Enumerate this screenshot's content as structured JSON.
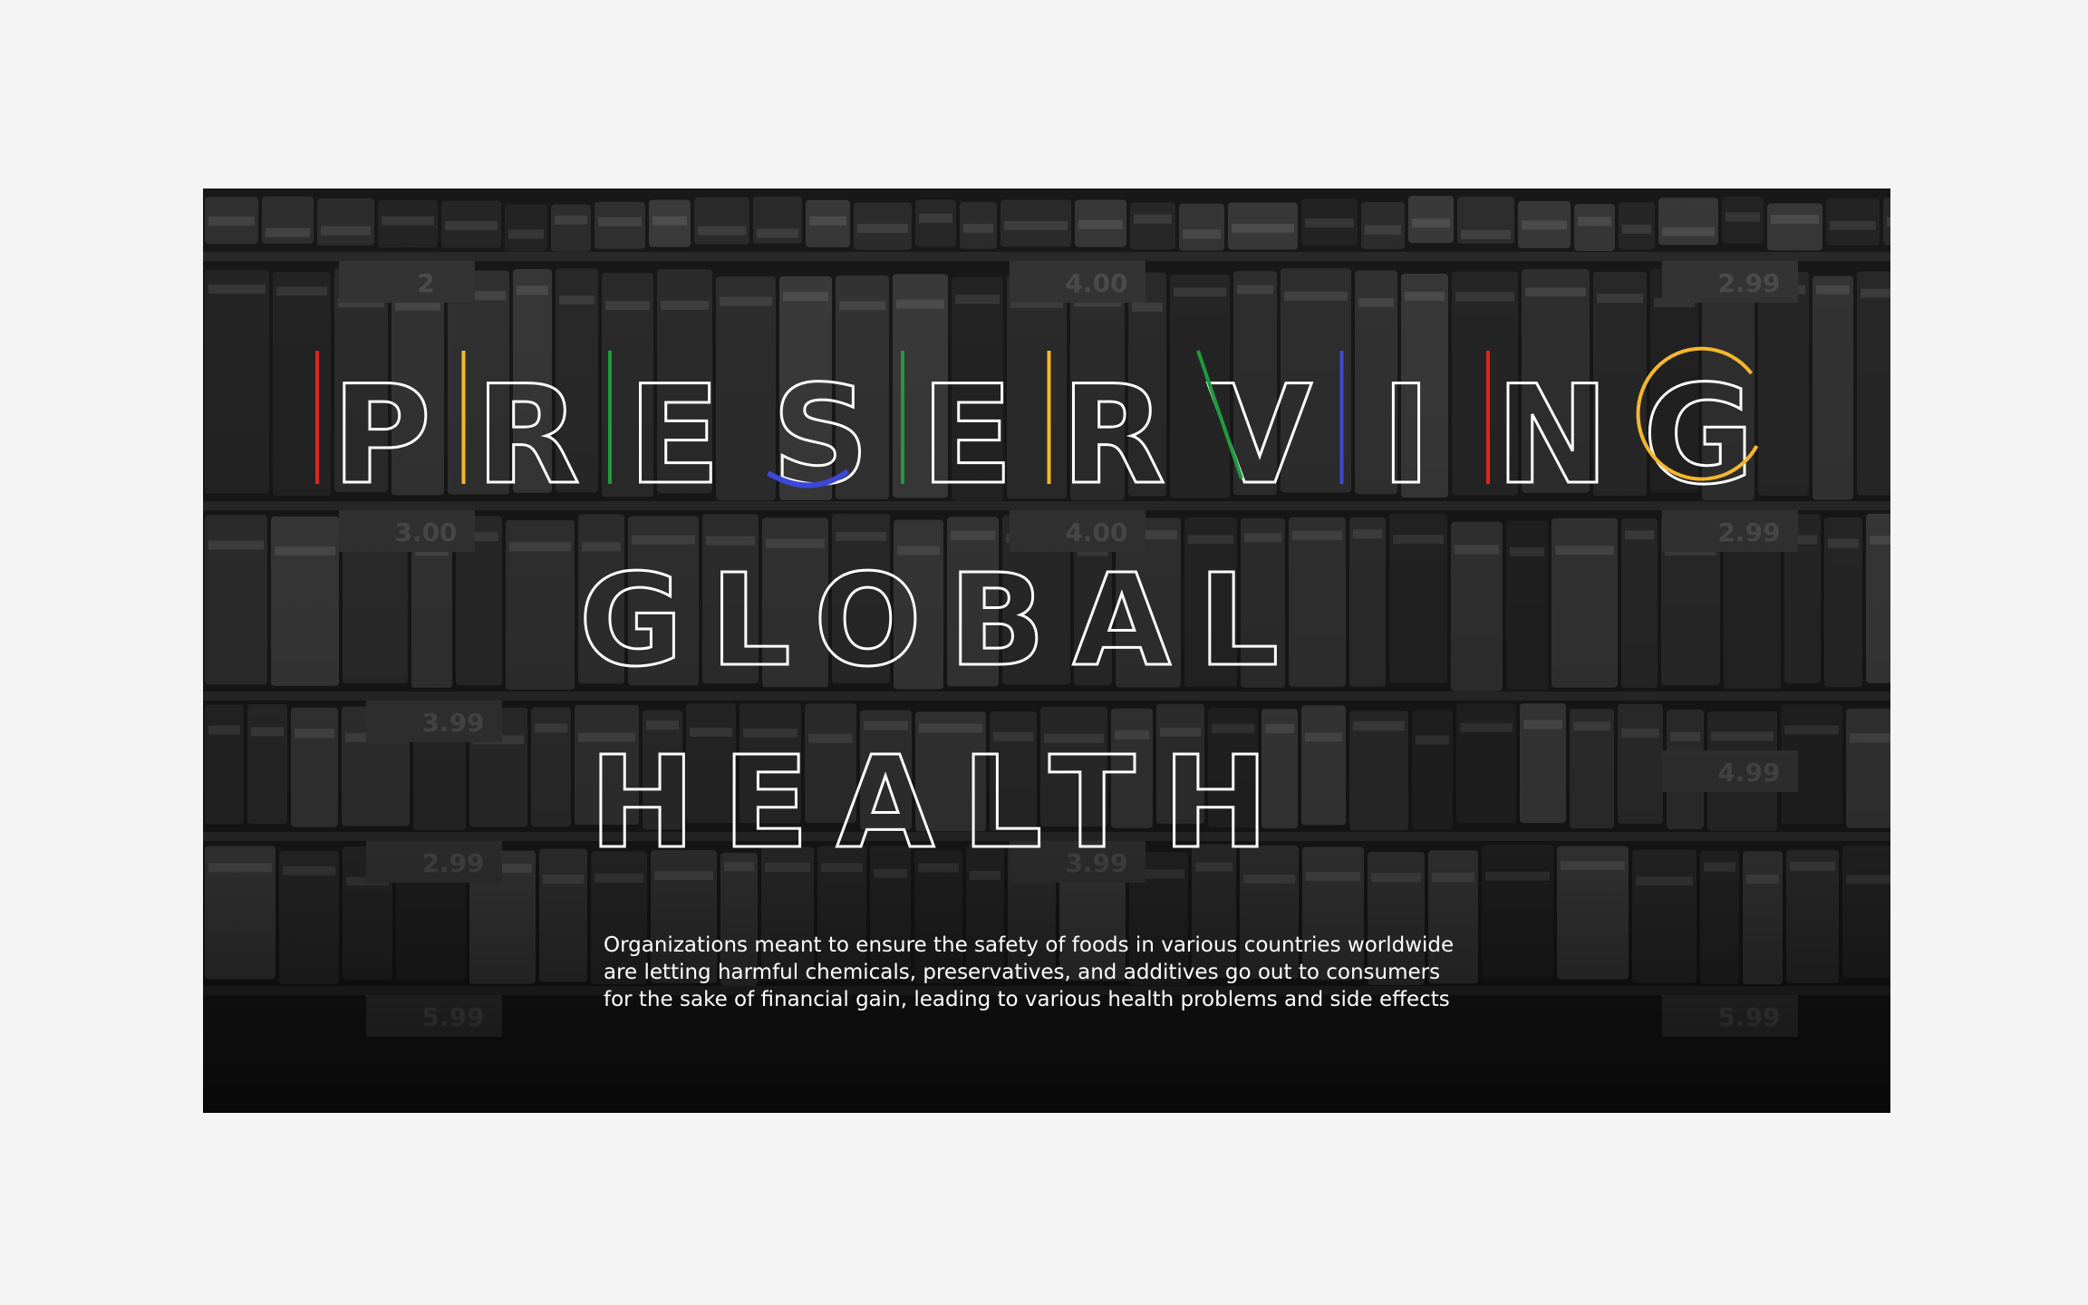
{
  "headline": {
    "line1": [
      "P",
      "R",
      "E",
      "S",
      "E",
      "R",
      "V",
      "I",
      "N",
      "G"
    ],
    "line2": "GLOBAL",
    "line3": "HEALTH"
  },
  "accent_colors": {
    "red": "#e0251b",
    "yellow": "#f4b72e",
    "green": "#1f9a3e",
    "blue": "#3c48d8"
  },
  "price_tags": [
    "2",
    "4.00",
    "2.99",
    "3.00",
    "4.00",
    "2.99",
    "3.99",
    "4.99",
    "2.99",
    "3.99",
    "5.99",
    "5.99"
  ],
  "body": {
    "line1": "Organizations meant to ensure the safety of foods in various countries worldwide",
    "line2": "are letting harmful chemicals, preservatives, and additives go out to consumers",
    "line3": "for the sake of financial gain, leading to various health problems and side effects"
  }
}
